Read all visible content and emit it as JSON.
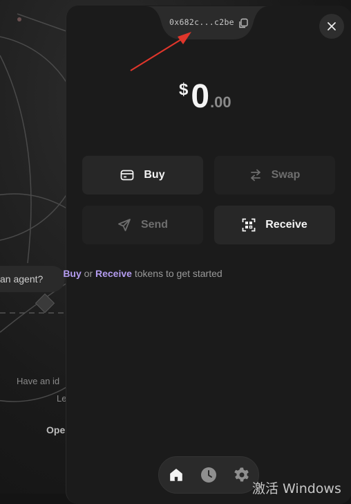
{
  "background": {
    "agent_pill_label": "an agent?",
    "partial_text_1": "Have an id",
    "partial_text_2": "Le",
    "partial_link": "Ope"
  },
  "wallet": {
    "address_short": "0x682c...c2be",
    "balance": {
      "currency": "$",
      "integer": "0",
      "decimal": ".00"
    },
    "actions": [
      {
        "label": "Buy",
        "icon": "card-icon",
        "enabled": true
      },
      {
        "label": "Swap",
        "icon": "swap-icon",
        "enabled": false
      },
      {
        "label": "Send",
        "icon": "send-icon",
        "enabled": false
      },
      {
        "label": "Receive",
        "icon": "qr-scan-icon",
        "enabled": true
      }
    ],
    "hint": {
      "buy": "Buy",
      "or": " or ",
      "receive": "Receive",
      "rest": " tokens to get started"
    },
    "nav": [
      "home-icon",
      "history-icon",
      "settings-icon"
    ]
  },
  "colors": {
    "accent_purple": "#b49cf0",
    "panel_bg": "#1b1b1b",
    "button_bg": "#272727",
    "annotation_arrow": "#e0362b"
  },
  "watermark": "激活 Windows"
}
